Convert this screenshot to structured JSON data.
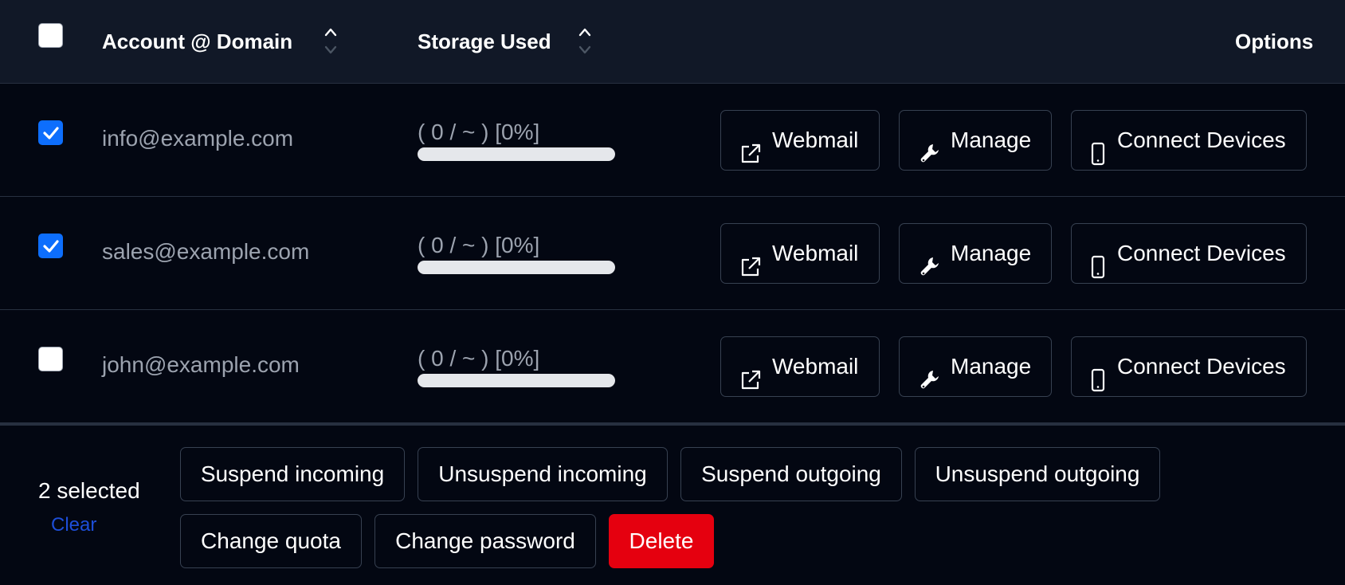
{
  "header": {
    "account_label": "Account @ Domain",
    "storage_label": "Storage Used",
    "options_label": "Options",
    "select_all_checked": false
  },
  "rows": [
    {
      "email": "info@example.com",
      "storage": "( 0 / ~ ) [0%]",
      "usage_percent": 0,
      "checked": true
    },
    {
      "email": "sales@example.com",
      "storage": "( 0 / ~ ) [0%]",
      "usage_percent": 0,
      "checked": true
    },
    {
      "email": "john@example.com",
      "storage": "( 0 / ~ ) [0%]",
      "usage_percent": 0,
      "checked": false
    }
  ],
  "row_actions": {
    "webmail": "Webmail",
    "manage": "Manage",
    "connect": "Connect Devices",
    "webmail_icon": "external-link-icon",
    "manage_icon": "wrench-icon",
    "connect_icon": "phone-icon"
  },
  "footer": {
    "selected_text": "2 selected",
    "clear_label": "Clear",
    "suspend_incoming": "Suspend incoming",
    "unsuspend_incoming": "Unsuspend incoming",
    "suspend_outgoing": "Suspend outgoing",
    "unsuspend_outgoing": "Unsuspend outgoing",
    "change_quota": "Change quota",
    "change_password": "Change password",
    "delete": "Delete"
  },
  "colors": {
    "background": "#030712",
    "header_background": "#111827",
    "checkbox_checked": "#0d6efd",
    "link": "#1d4ed8",
    "danger": "#e5000f",
    "muted_text": "#9ca3af"
  }
}
